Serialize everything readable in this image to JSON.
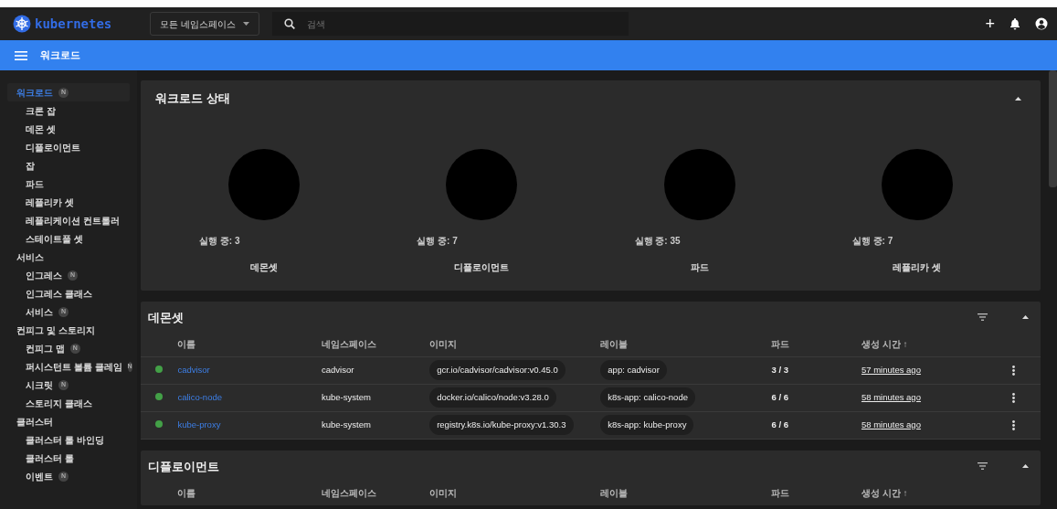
{
  "topbar": {
    "logo_text": "kubernetes",
    "namespace_select": "모든 네임스페이스",
    "search": {
      "placeholder": "검색"
    },
    "actions": [
      "+"
    ]
  },
  "header": {
    "title": "워크로드"
  },
  "sidebar": {
    "groups": [
      {
        "label": "워크로드",
        "badge": "N",
        "selected": true,
        "children": [
          {
            "label": "크론 잡"
          },
          {
            "label": "데몬 셋"
          },
          {
            "label": "디플로이먼트"
          },
          {
            "label": "잡"
          },
          {
            "label": "파드"
          },
          {
            "label": "레플리카 셋"
          },
          {
            "label": "레플리케이션 컨트롤러"
          },
          {
            "label": "스테이트풀 셋"
          }
        ]
      },
      {
        "label": "서비스",
        "selected": false,
        "children": [
          {
            "label": "인그레스",
            "badge": "N"
          },
          {
            "label": "인그레스 클래스"
          },
          {
            "label": "서비스",
            "badge": "N"
          }
        ]
      },
      {
        "label": "컨피그 및 스토리지",
        "selected": false,
        "children": [
          {
            "label": "컨피그 맵",
            "badge": "N"
          },
          {
            "label": "퍼시스턴트 볼륨 클레임",
            "badge": "N"
          },
          {
            "label": "시크릿",
            "badge": "N"
          },
          {
            "label": "스토리지 클래스"
          }
        ]
      },
      {
        "label": "클러스터",
        "selected": false,
        "children": [
          {
            "label": "클러스터 롤 바인딩"
          },
          {
            "label": "클러스터 롤"
          },
          {
            "label": "이벤트",
            "badge": "N"
          }
        ]
      }
    ]
  },
  "status_card": {
    "title": "워크로드 상태",
    "expanded": true,
    "items": [
      {
        "running": "실행 중: 3",
        "name": "데몬셋"
      },
      {
        "running": "실행 중: 7",
        "name": "디플로이먼트"
      },
      {
        "running": "실행 중: 35",
        "name": "파드"
      },
      {
        "running": "실행 중: 7",
        "name": "레플리카 셋"
      }
    ]
  },
  "tables": [
    {
      "title": "데몬셋",
      "expanded": true,
      "columns": [
        "이름",
        "네임스페이스",
        "이미지",
        "레이블",
        "파드",
        "생성 시간 ↑"
      ],
      "rows": [
        {
          "color": "#43a047",
          "name": "cadvisor",
          "namespace": "cadvisor",
          "image": "gcr.io/cadvisor/cadvisor:v0.45.0",
          "label": "app: cadvisor",
          "pods": "3 / 3",
          "created": "57 minutes ago"
        },
        {
          "color": "#43a047",
          "name": "calico-node",
          "namespace": "kube-system",
          "image": "docker.io/calico/node:v3.28.0",
          "label": "k8s-app: calico-node",
          "pods": "6 / 6",
          "created": "58 minutes ago"
        },
        {
          "color": "#43a047",
          "name": "kube-proxy",
          "namespace": "kube-system",
          "image": "registry.k8s.io/kube-proxy:v1.30.3",
          "label": "k8s-app: kube-proxy",
          "pods": "6 / 6",
          "created": "58 minutes ago"
        }
      ]
    },
    {
      "title": "디플로이먼트",
      "expanded": true,
      "columns": [
        "이름",
        "네임스페이스",
        "이미지",
        "레이블",
        "파드",
        "생성 시간 ↑"
      ]
    }
  ]
}
